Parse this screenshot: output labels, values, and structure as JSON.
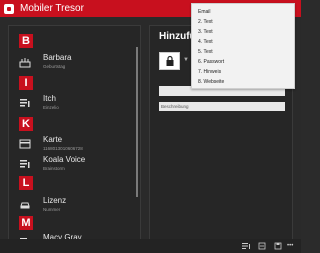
{
  "app": {
    "title": "Mobiler Tresor",
    "accent_color": "#c8101e"
  },
  "list": {
    "entries": [
      {
        "type": "header",
        "label": "B"
      },
      {
        "type": "item",
        "name": "Barbara",
        "sub": "Geburtstag",
        "icon": "birthday-icon"
      },
      {
        "type": "header",
        "label": "I"
      },
      {
        "type": "item",
        "name": "Itch",
        "sub": "Einzelio",
        "icon": "text-list-icon"
      },
      {
        "type": "header",
        "label": "K"
      },
      {
        "type": "item",
        "name": "Karte",
        "sub": "1168013010606728",
        "icon": "card-icon"
      },
      {
        "type": "item",
        "name": "Koala Voice",
        "sub": "Brainstorm",
        "icon": "text-list-icon"
      },
      {
        "type": "header",
        "label": "L"
      },
      {
        "type": "item",
        "name": "Lizenz",
        "sub": "Nummer",
        "icon": "car-icon"
      },
      {
        "type": "header",
        "label": "M"
      },
      {
        "type": "item",
        "name": "Macy Gray",
        "sub": "",
        "icon": "text-list-icon"
      }
    ]
  },
  "detail": {
    "title": "Hinzufüg",
    "description_placeholder": "Beschreibung"
  },
  "dropdown": {
    "items": [
      "Email",
      "2. Text",
      "3. Text",
      "4. Text",
      "5. Text",
      "6. Passwort",
      "7. Hinweis",
      "8. Webseite"
    ]
  }
}
